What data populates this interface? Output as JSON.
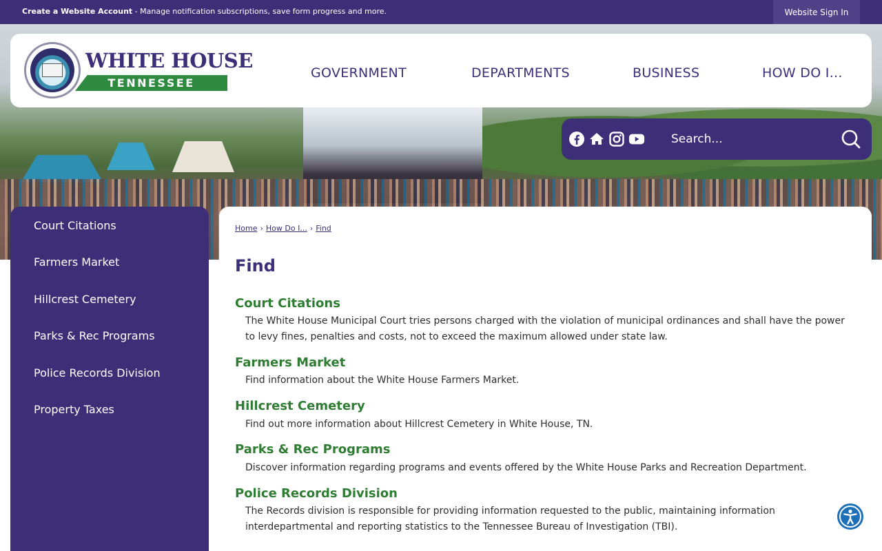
{
  "topbar": {
    "account_bold": "Create a Website Account",
    "account_text": " - Manage notification subscriptions, save form progress and more.",
    "signin": "Website Sign In"
  },
  "logo": {
    "title": "WHITE HOUSE",
    "subtitle": "TENNESSEE"
  },
  "nav": [
    "GOVERNMENT",
    "DEPARTMENTS",
    "BUSINESS",
    "HOW DO I..."
  ],
  "social_icons": [
    "facebook-icon",
    "home-icon",
    "instagram-icon",
    "youtube-icon"
  ],
  "search": {
    "placeholder": "Search..."
  },
  "sidebar": {
    "items": [
      "Court Citations",
      "Farmers Market",
      "Hillcrest Cemetery",
      "Parks & Rec Programs",
      "Police Records Division",
      "Property Taxes"
    ]
  },
  "breadcrumb": [
    "Home",
    "How Do I...",
    "Find"
  ],
  "page_title": "Find",
  "entries": [
    {
      "title": "Court Citations",
      "desc": "The White House Municipal Court tries persons charged with the violation of municipal ordinances and shall have the power to levy fines, penalties and costs, not to exceed the maximum allowed under state law."
    },
    {
      "title": "Farmers Market",
      "desc": "Find information about the White House Farmers Market."
    },
    {
      "title": "Hillcrest Cemetery",
      "desc": "Find out more information about Hillcrest Cemetery in White House, TN."
    },
    {
      "title": "Parks & Rec Programs",
      "desc": "Discover information regarding programs and events offered by the White House Parks and Recreation Department."
    },
    {
      "title": "Police Records Division",
      "desc": "The Records division is responsible for providing information requested to the public, maintaining information interdepartmental and reporting statistics to the Tennessee Bureau of Investigation (TBI)."
    }
  ],
  "colors": {
    "brand_purple": "#3d2f77",
    "brand_green": "#2e7d32",
    "accessibility_blue": "#1d6fb8"
  }
}
